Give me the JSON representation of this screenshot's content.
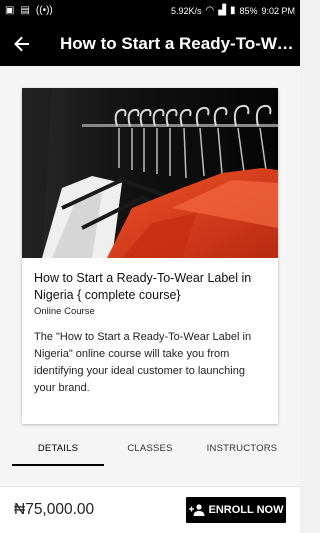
{
  "status_bar": {
    "speed": "5.92K/s",
    "battery": "85%",
    "time": "9:02 PM"
  },
  "app_bar": {
    "title": "How to Start a Ready-To-Wear Label in Nigeria { complete course}"
  },
  "course": {
    "title": "How to Start a Ready-To-Wear Label in Nigeria { complete course}",
    "category": "Online Course",
    "description": "The \"How to Start a Ready-To-Wear Label in Nigeria\" online course will take you from identifying your ideal customer to launching your brand."
  },
  "tabs": [
    {
      "label": "DETAILS"
    },
    {
      "label": "CLASSES"
    },
    {
      "label": "INSTRUCTORS"
    }
  ],
  "bottom": {
    "price": "₦75,000.00",
    "enroll_label": "ENROLL NOW"
  },
  "colors": {
    "app_bar": "#000000",
    "accent": "#000000",
    "jacket": "#e8401c"
  },
  "icons": [
    "back-arrow-icon",
    "add-person-icon",
    "wifi-icon",
    "battery-icon"
  ]
}
